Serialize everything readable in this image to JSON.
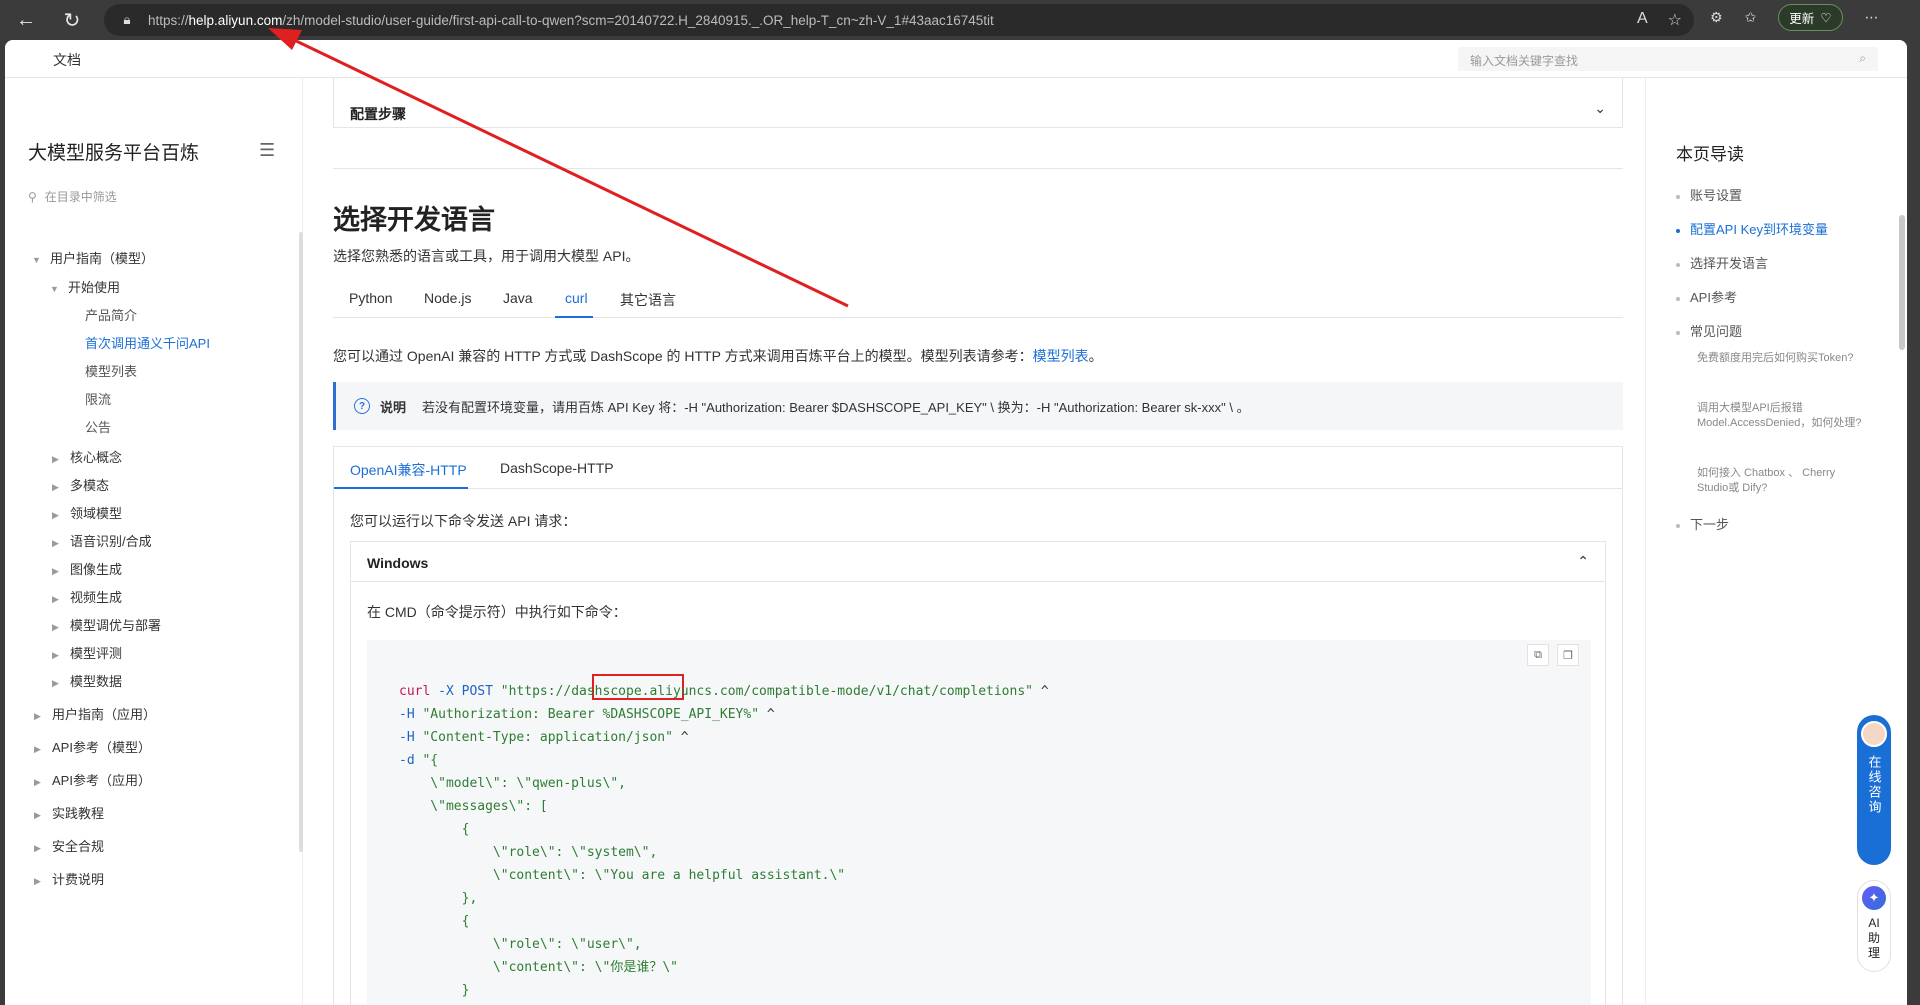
{
  "browser": {
    "url_prefix": "https://",
    "url_host": "help.aliyun.com",
    "url_rest": "/zh/model-studio/user-guide/first-api-call-to-qwen?scm=20140722.H_2840915._.OR_help-T_cn~zh-V_1#43aac16745tit",
    "update_label": "更新"
  },
  "topbar": {
    "doc_label": "文档",
    "search_placeholder": "输入文档关键字查找"
  },
  "sidebar": {
    "title": "大模型服务平台百炼",
    "filter_placeholder": "在目录中筛选",
    "items": [
      {
        "label": "用户指南（模型）"
      },
      {
        "label": "开始使用"
      },
      {
        "label": "产品简介"
      },
      {
        "label": "首次调用通义千问API"
      },
      {
        "label": "模型列表"
      },
      {
        "label": "限流"
      },
      {
        "label": "公告"
      },
      {
        "label": "核心概念"
      },
      {
        "label": "多模态"
      },
      {
        "label": "领域模型"
      },
      {
        "label": "语音识别/合成"
      },
      {
        "label": "图像生成"
      },
      {
        "label": "视频生成"
      },
      {
        "label": "模型调优与部署"
      },
      {
        "label": "模型评测"
      },
      {
        "label": "模型数据"
      },
      {
        "label": "用户指南（应用）"
      },
      {
        "label": "API参考（模型）"
      },
      {
        "label": "API参考（应用）"
      },
      {
        "label": "实践教程"
      },
      {
        "label": "安全合规"
      },
      {
        "label": "计费说明"
      }
    ]
  },
  "main": {
    "config_section_title": "配置步骤",
    "heading": "选择开发语言",
    "intro": "选择您熟悉的语言或工具，用于调用大模型 API。",
    "lang_tabs": [
      "Python",
      "Node.js",
      "Java",
      "curl",
      "其它语言"
    ],
    "active_lang_tab": "curl",
    "desc_text": "您可以通过 OpenAI 兼容的 HTTP 方式或 DashScope 的 HTTP 方式来调用百炼平台上的模型。模型列表请参考：",
    "desc_link": "模型列表",
    "desc_end": "。",
    "note_label": "说明",
    "note_text": "若没有配置环境变量，请用百炼 API Key 将：-H \"Authorization: Bearer $DASHSCOPE_API_KEY\" \\ 换为：-H \"Authorization: Bearer sk-xxx\" \\ 。",
    "api_tabs": [
      "OpenAI兼容-HTTP",
      "DashScope-HTTP"
    ],
    "api_intro": "您可以运行以下命令发送 API 请求：",
    "windows_title": "Windows",
    "windows_desc": "在 CMD（命令提示符）中执行如下命令：",
    "code": {
      "l1_cmd": "curl",
      "l1_flag": "-X",
      "l1_method": "POST",
      "l1_url": "\"https://dashscope.aliyuncs.com/compatible-mode/v1/chat/completions\"",
      "l1_cont": "^",
      "l2_flag": "-H",
      "l2_val": "\"Authorization: Bearer %DASHSCOPE_API_KEY%\"",
      "l2_cont": "^",
      "l3_flag": "-H",
      "l3_val": "\"Content-Type: application/json\"",
      "l3_cont": "^",
      "l4_flag": "-d",
      "l4_val": "\"{",
      "l5": "    \\\"model\\\": \\\"qwen-plus\\\",",
      "l6": "    \\\"messages\\\": [",
      "l7": "        {",
      "l8": "            \\\"role\\\": \\\"system\\\",",
      "l9": "            \\\"content\\\": \\\"You are a helpful assistant.\\\"",
      "l10": "        },",
      "l11": "        {",
      "l12": "            \\\"role\\\": \\\"user\\\",",
      "l13": "            \\\"content\\\": \\\"你是谁？\\\"",
      "l14": "        }",
      "l15": "    ]",
      "l16": "}\""
    }
  },
  "toc": {
    "title": "本页导读",
    "items": [
      {
        "label": "账号设置"
      },
      {
        "label": "配置API Key到环境变量"
      },
      {
        "label": "选择开发语言"
      },
      {
        "label": "API参考"
      },
      {
        "label": "常见问题"
      }
    ],
    "faq": [
      {
        "label": "免费额度用完后如何购买Token?"
      },
      {
        "label": "调用大模型API后报错Model.AccessDenied，如何处理?"
      },
      {
        "label": "如何接入 Chatbox 、 Cherry Studio或 Dify?"
      }
    ],
    "next": "下一步"
  },
  "floating": {
    "consult": "在线咨询",
    "ai": "AI助理"
  },
  "colors": {
    "accent": "#1a6fd6",
    "annotation": "#e02020"
  }
}
